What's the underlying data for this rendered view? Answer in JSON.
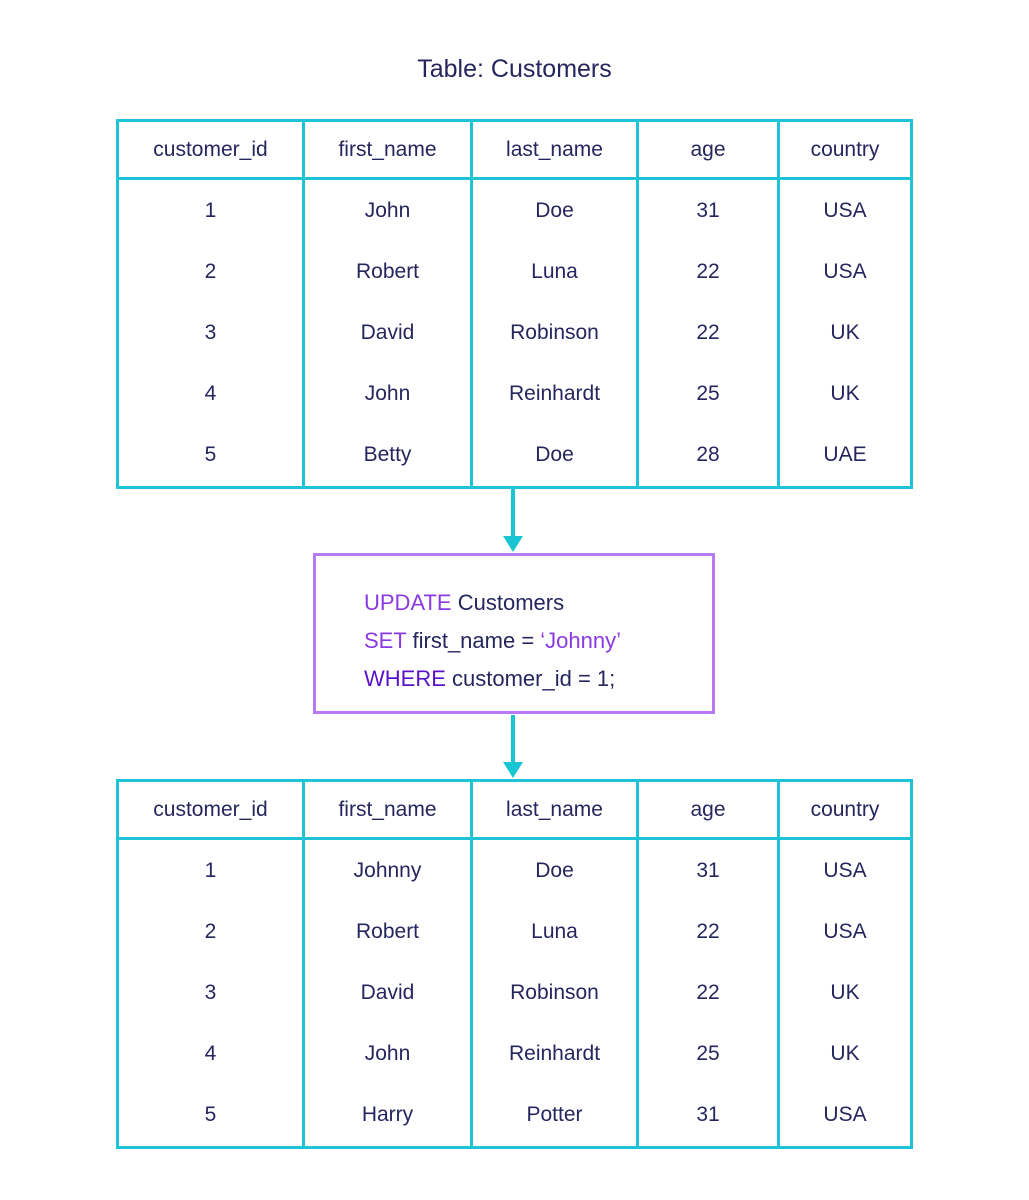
{
  "title": "Table: Customers",
  "colors": {
    "table_border": "#1ec3d6",
    "arrow": "#17c6d2",
    "sql_box_border": "#b77af0",
    "keyword": "#8a3ae3",
    "keyword_where": "#5a12c8",
    "text": "#25265e"
  },
  "columns": [
    "customer_id",
    "first_name",
    "last_name",
    "age",
    "country"
  ],
  "table_before": {
    "rows": [
      [
        "1",
        "John",
        "Doe",
        "31",
        "USA"
      ],
      [
        "2",
        "Robert",
        "Luna",
        "22",
        "USA"
      ],
      [
        "3",
        "David",
        "Robinson",
        "22",
        "UK"
      ],
      [
        "4",
        "John",
        "Reinhardt",
        "25",
        "UK"
      ],
      [
        "5",
        "Betty",
        "Doe",
        "28",
        "UAE"
      ]
    ]
  },
  "sql": {
    "lines": [
      {
        "keyword": "UPDATE",
        "rest": " Customers"
      },
      {
        "keyword": "SET",
        "rest": " first_name = ",
        "string": "‘Johnny’"
      },
      {
        "keyword": "WHERE",
        "rest": " customer_id = 1;"
      }
    ]
  },
  "table_after": {
    "rows": [
      [
        "1",
        "Johnny",
        "Doe",
        "31",
        "USA"
      ],
      [
        "2",
        "Robert",
        "Luna",
        "22",
        "USA"
      ],
      [
        "3",
        "David",
        "Robinson",
        "22",
        "UK"
      ],
      [
        "4",
        "John",
        "Reinhardt",
        "25",
        "UK"
      ],
      [
        "5",
        "Harry",
        "Potter",
        "31",
        "USA"
      ]
    ]
  }
}
